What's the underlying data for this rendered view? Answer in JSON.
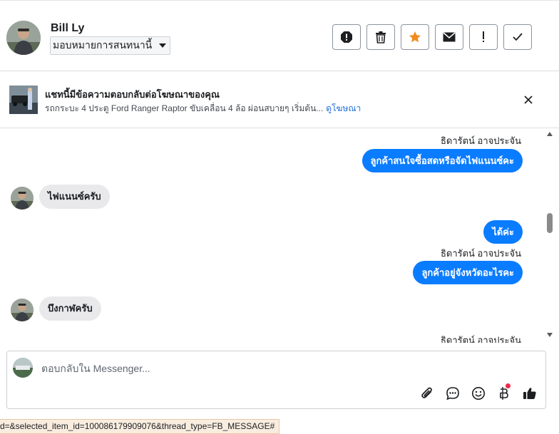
{
  "header": {
    "contact_name": "Bill Ly",
    "assign_label": "มอบหมายการสนทนานี้",
    "actions": [
      {
        "name": "spam-button",
        "icon": "alert-octagon-icon"
      },
      {
        "name": "delete-button",
        "icon": "trash-icon"
      },
      {
        "name": "star-button",
        "icon": "star-icon",
        "color": "#f28b1f"
      },
      {
        "name": "mark-unread-button",
        "icon": "envelope-icon"
      },
      {
        "name": "follow-up-button",
        "icon": "exclamation-icon"
      },
      {
        "name": "mark-done-button",
        "icon": "check-icon"
      }
    ]
  },
  "ad_banner": {
    "title": "แชทนี้มีข้อความตอบกลับต่อโฆษณาของคุณ",
    "description": "รถกระบะ 4 ประตู Ford Ranger Raptor ขับเคลื่อน 4 ล้อ ผ่อนสบายๆ เริ่มต้น...",
    "link": "ดูโฆษณา"
  },
  "messages": {
    "sender_1": "ธิดารัตน์ อาจประจัน",
    "out_1": "ลูกค้าสนใจซื้อสดหรือจัดไฟแนนซ์คะ",
    "in_1": "ไฟแนนซ์ครับ",
    "out_2": "ได้ค่ะ",
    "sender_2": "ธิดารัตน์ อาจประจัน",
    "out_3": "ลูกค้าอยู่จังหวัดอะไรคะ",
    "in_2": "บึงกาฬครับ",
    "sender_3": "ธิดารัตน์ อาจประจัน"
  },
  "composer": {
    "placeholder": "ตอบกลับใน Messenger...",
    "icons": [
      "attachment-icon",
      "saved-reply-icon",
      "emoji-icon",
      "payment-icon",
      "like-icon"
    ],
    "notification_color": "#f02849"
  },
  "status_url": "d=&selected_item_id=100086179909076&thread_type=FB_MESSAGE#",
  "colors": {
    "outgoing_bubble": "#0a7cff",
    "incoming_bubble": "#e9e9eb",
    "link": "#216fdb"
  }
}
